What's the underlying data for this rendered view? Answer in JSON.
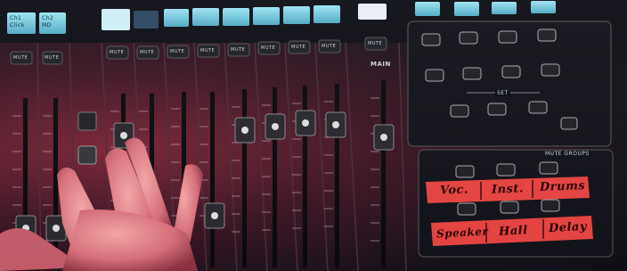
{
  "screens": [
    {
      "line1": "Ch1",
      "line2": "Click"
    },
    {
      "line1": "Ch2",
      "line2": "MD"
    }
  ],
  "mute_label": "MUTE",
  "main_label": "MAIN",
  "set_label": "SET",
  "mute_groups_label": "MUTE GROUPS",
  "tape_labels": {
    "row1": [
      "Voc.",
      "Inst.",
      "Drums"
    ],
    "row2": [
      "Speaker",
      "Hall",
      "Delay"
    ]
  },
  "colors": {
    "mute_red": "#d7242a",
    "tape_red": "#e4423f",
    "screen_cyan": "#7fd3e8",
    "backlight": "#7a2436"
  }
}
